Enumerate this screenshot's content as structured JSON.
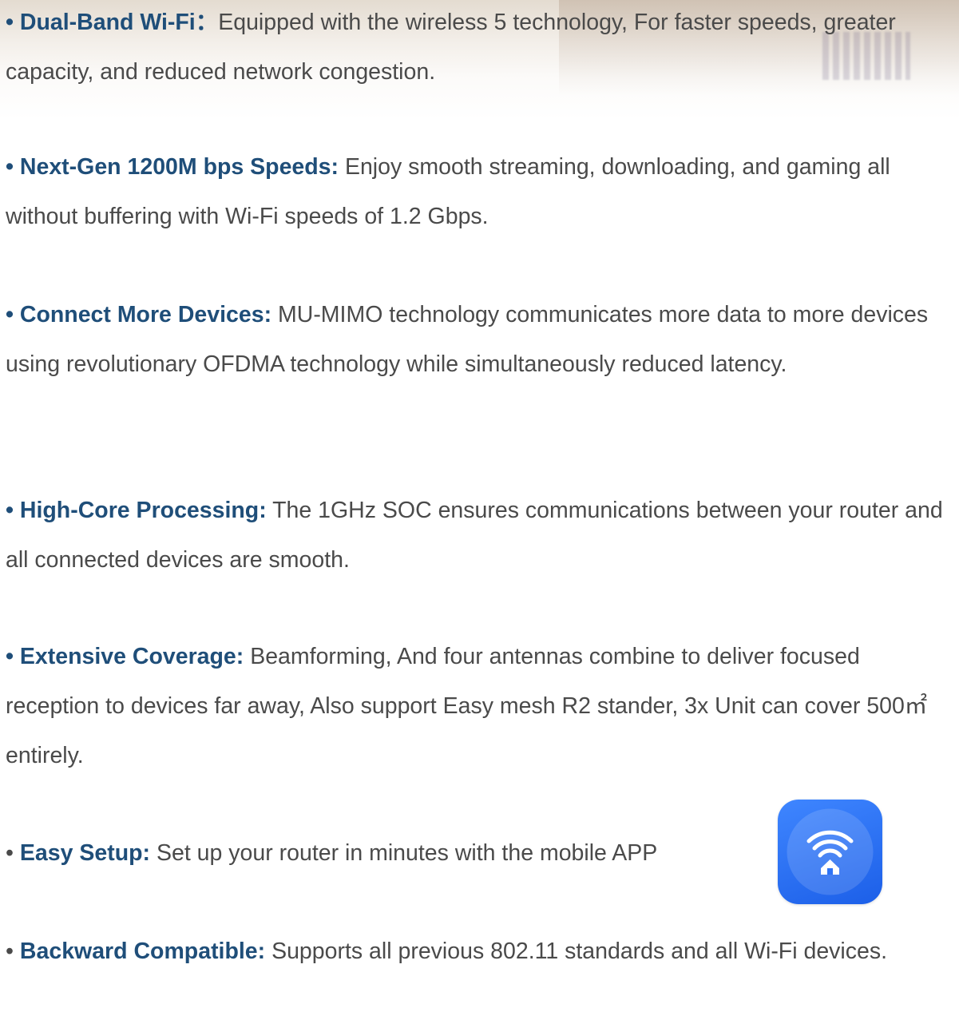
{
  "features": [
    {
      "lead": "• Dual-Band Wi-Fi：",
      "body": "Equipped with the wireless 5 technology, For faster speeds, greater capacity, and reduced network congestion."
    },
    {
      "lead": "• Next-Gen 1200M bps Speeds:",
      "body": " Enjoy smooth streaming, downloading, and gaming all without buffering with Wi-Fi speeds of 1.2 Gbps."
    },
    {
      "lead": "• Connect More Devices:",
      "body": " MU-MIMO technology communicates more data to more devices using revolutionary OFDMA technology while simultaneously reduced latency."
    },
    {
      "lead": "• High-Core Processing:",
      "body": " The 1GHz SOC ensures communications between your router and all connected devices are smooth."
    },
    {
      "lead": "• Extensive Coverage:",
      "body": " Beamforming, And four antennas combine to deliver focused reception to devices far away, Also support Easy mesh R2 stander, 3x Unit can cover 500㎡entirely."
    },
    {
      "bullet": "• ",
      "lead": "Easy Setup:",
      "body": " Set up your router in minutes with the mobile APP"
    },
    {
      "bullet": "• ",
      "lead": "Backward Compatible:",
      "body": " Supports all previous 802.11 standards and all Wi-Fi devices."
    }
  ],
  "app_icon": {
    "name": "wifi-home-app-icon",
    "color": "#2f74f5"
  },
  "colors": {
    "lead_text": "#1f4e79",
    "body_text": "#4a4a4a"
  }
}
